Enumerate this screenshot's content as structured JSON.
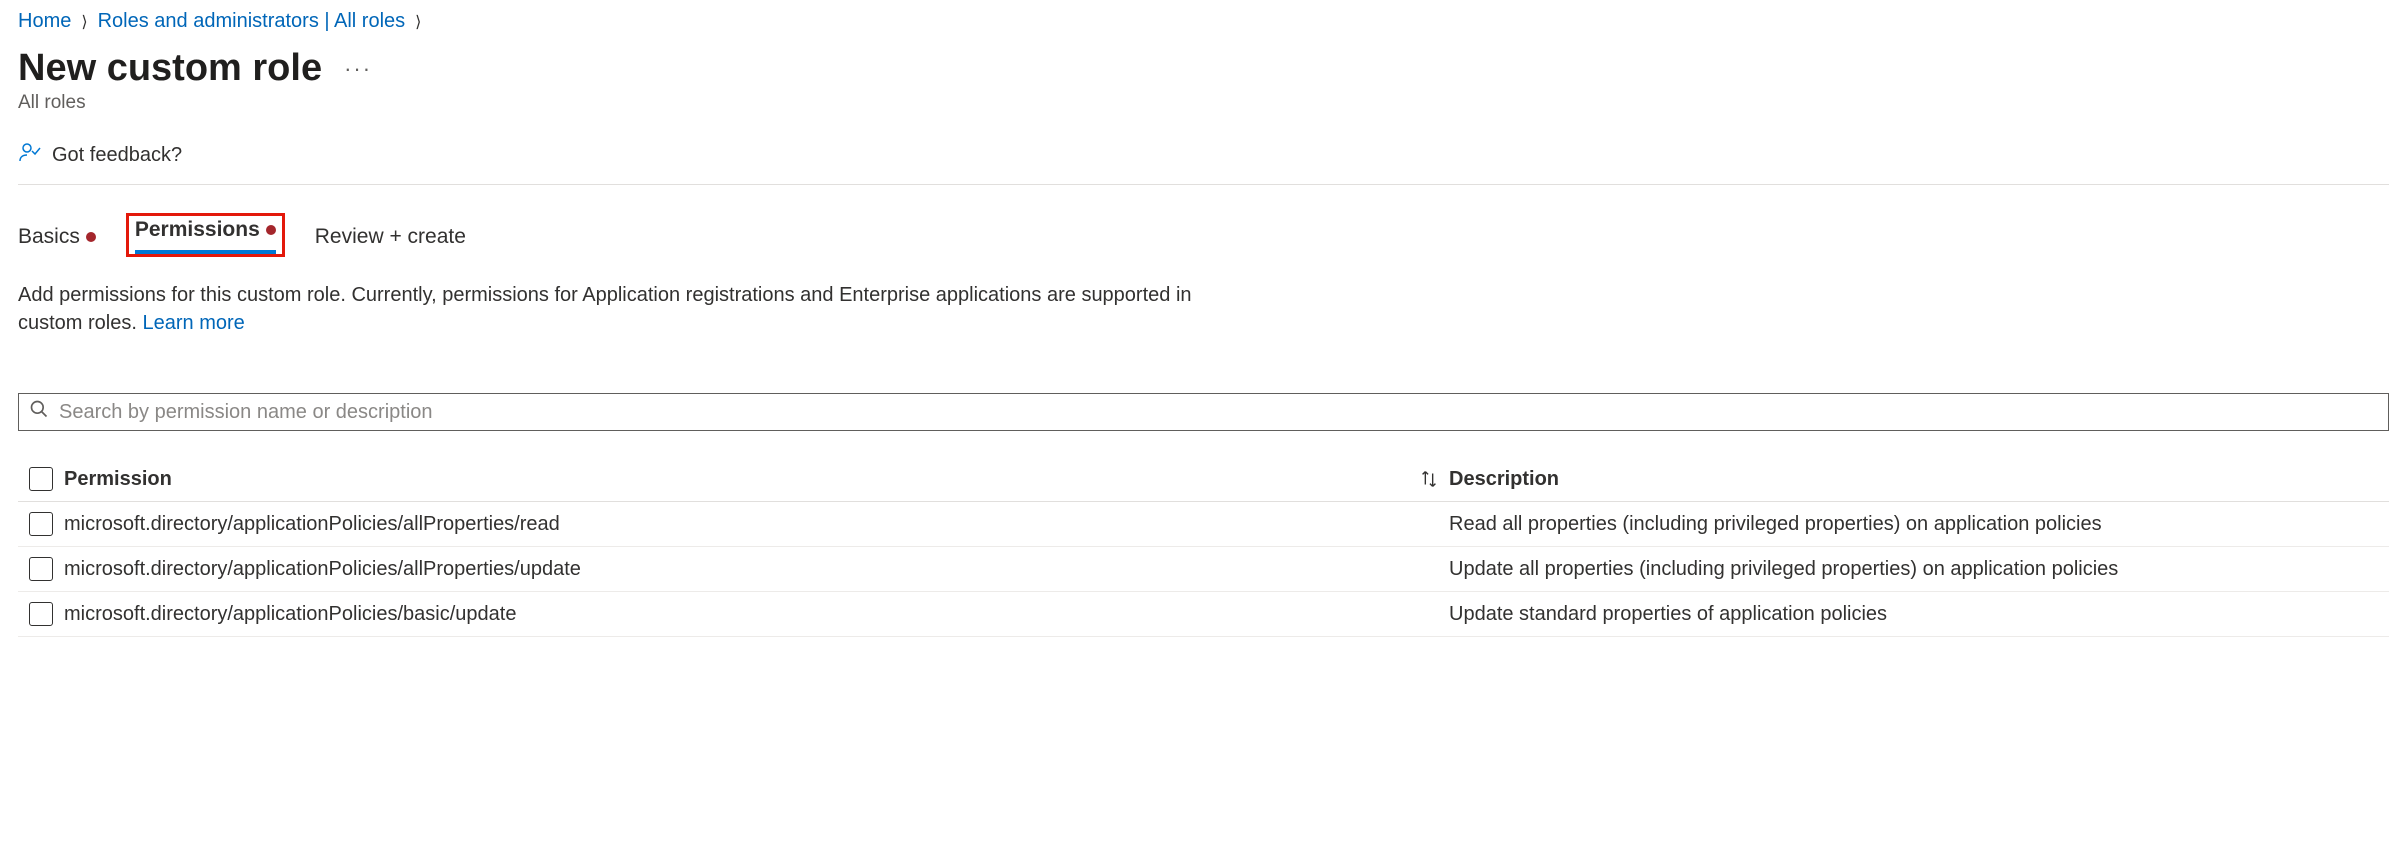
{
  "breadcrumb": {
    "home": "Home",
    "roles": "Roles and administrators | All roles"
  },
  "page": {
    "title": "New custom role",
    "subtitle": "All roles"
  },
  "feedback": {
    "label": "Got feedback?"
  },
  "tabs": {
    "basics": "Basics",
    "permissions": "Permissions",
    "review": "Review + create"
  },
  "description": {
    "text": "Add permissions for this custom role. Currently, permissions for Application registrations and Enterprise applications are supported in custom roles. ",
    "learn_more": "Learn more"
  },
  "search": {
    "placeholder": "Search by permission name or description"
  },
  "table": {
    "header_permission": "Permission",
    "header_description": "Description",
    "rows": [
      {
        "perm": "microsoft.directory/applicationPolicies/allProperties/read",
        "desc": "Read all properties (including privileged properties) on application policies"
      },
      {
        "perm": "microsoft.directory/applicationPolicies/allProperties/update",
        "desc": "Update all properties (including privileged properties) on application policies"
      },
      {
        "perm": "microsoft.directory/applicationPolicies/basic/update",
        "desc": "Update standard properties of application policies"
      }
    ]
  }
}
